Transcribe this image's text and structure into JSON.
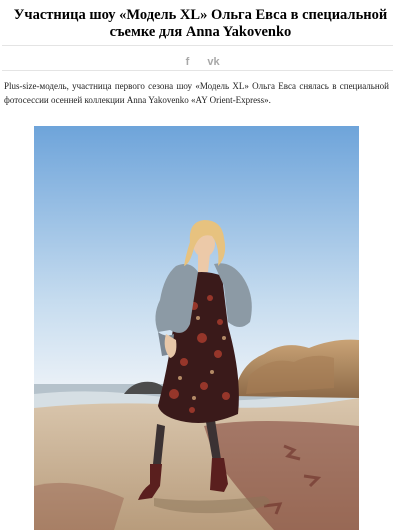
{
  "article": {
    "title_line1": "Участница шоу «Модель XL» Ольга Евса в специальной",
    "title_line2": "съемке для Anna Yakovenko",
    "lead": "Plus-size-модель, участница первого сезона шоу «Модель XL» Ольга Евса снялась в специальной фотосессии осенней коллекции Anna Yakovenko «AY Orient-Express».",
    "share": [
      {
        "icon": "facebook-icon",
        "glyph": "f"
      },
      {
        "icon": "vk-icon",
        "glyph": "vk"
      }
    ],
    "photo": {
      "subject": "model in dark floral dress and grey coat on a beach",
      "colors": {
        "sky_top": "#6fa6dc",
        "sky_bottom": "#e7f0f8",
        "sand": "#cdb79b",
        "cliff": "#b88d62",
        "sea": "#a9b7c2"
      }
    }
  }
}
